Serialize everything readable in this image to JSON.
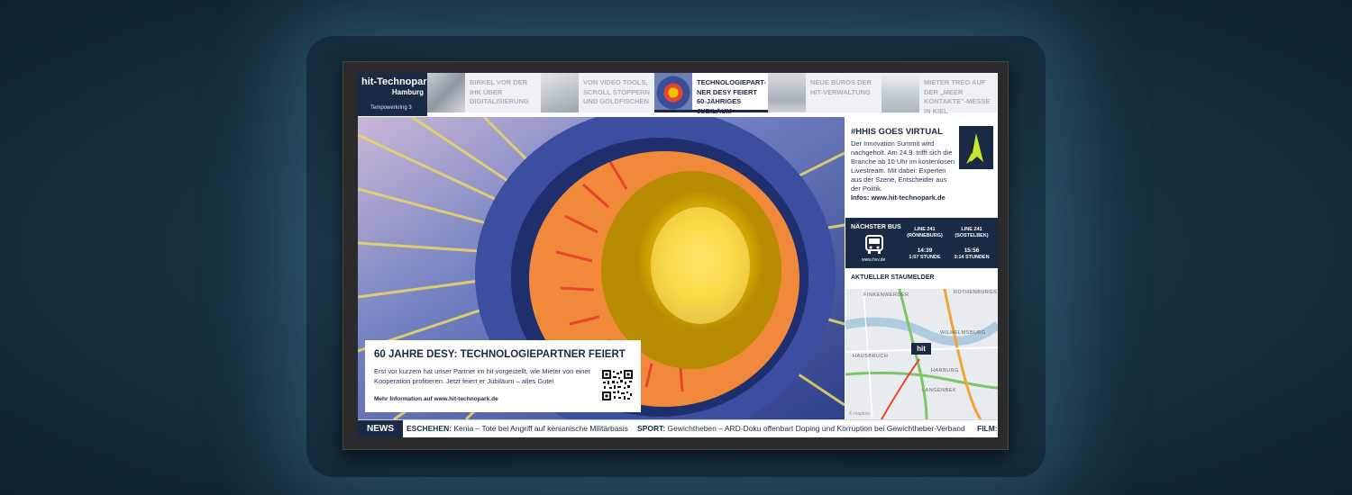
{
  "brand": {
    "title": "hit-Technopark",
    "city": "Hamburg",
    "address": "Tempowerkring 3"
  },
  "tabs": [
    {
      "label": "BIRKEL VOR DER IHK ÜBER DIGITALISIERUNG",
      "active": false
    },
    {
      "label": "VON VIDEO TOOLS, SCROLL STOPPERN UND GOLDFISCHEN",
      "active": false
    },
    {
      "label": "TECHNOLOGIEPART-NER DESY FEIERT 60-JÄHRIGES JUBILÄUM",
      "active": true
    },
    {
      "label": "NEUE BÜROS DER HIT-VERWALTUNG",
      "active": false
    },
    {
      "label": "MIETER TREO AUF DER „MEER KONTAKTE\"-MESSE IN KIEL",
      "active": false
    }
  ],
  "hero": {
    "title": "60 JAHRE DESY: TECHNOLOGIEPARTNER FEIERT",
    "body": "Erst vor kurzem hat unser Partner im hit vorgestellt, wie Mieter von einer Kooperation profitieren. Jetzt feiert er Jubiläum – alles Gute!",
    "link": "Mehr Information auf www.hit-technopark.de"
  },
  "promo": {
    "title": "#HHIS GOES VIRTUAL",
    "body": "Der Innovation Summit wird nachgeholt. Am 24.9. trifft sich die Branche ab 10 Uhr im kostenlosen Livestream. Mit dabei: Experten aus der Szene, Entscheider aus der Politik.",
    "info_label": "Infos:",
    "info_url": "www.hit-technopark.de"
  },
  "bus": {
    "title": "NÄCHSTER BUS",
    "source": "www.hvv.de",
    "lines": [
      {
        "line": "LINE 241",
        "dest": "(RÖNNEBURG)",
        "time": "14:39",
        "wait": "1:57 STUNDE"
      },
      {
        "line": "LINE 241",
        "dest": "(SOSTELBEK)",
        "time": "15:56",
        "wait": "3:14 STUNDEN"
      }
    ]
  },
  "map": {
    "title": "AKTUELLER STAUMELDER",
    "labels": [
      "FINKENWERDER",
      "ROTHENBURGS",
      "WILHELMSBURG",
      "HAUSBRUCH",
      "HARBURG",
      "LANGENBEK"
    ],
    "marker": "hit",
    "attribution": "© mapbox"
  },
  "ticker": {
    "badge": "NEWS",
    "items": [
      {
        "label": "ESCHEHEN:",
        "text": "Kenia – Tote bei Angriff auf kenianische Militärbasis"
      },
      {
        "label": "SPORT:",
        "text": "Gewichtheben – ARD-Doku offenbart Doping und Korruption bei Gewichtheber-Verband"
      },
      {
        "label": "FILM:",
        "text": ""
      }
    ]
  },
  "colors": {
    "navy": "#1a2a44",
    "accent_green": "#c8e62e",
    "hero_red": "#e8452a"
  }
}
